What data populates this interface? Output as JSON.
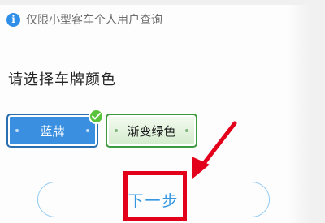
{
  "notice": {
    "icon": "info-icon",
    "icon_glyph": "i",
    "text": "仅限小型客车个人用户查询"
  },
  "prompt": {
    "text": "请选择车牌颜色"
  },
  "plates": [
    {
      "label": "蓝牌",
      "color": "#3a8fe0",
      "selected": true
    },
    {
      "label": "渐变绿色",
      "color": "#3d9a3d",
      "selected": false
    }
  ],
  "selected_badge": {
    "icon": "check-icon",
    "color": "#5bc23c"
  },
  "next_button": {
    "label": "下一步",
    "color": "#3597e2"
  },
  "annotation": {
    "color": "#e3001b"
  }
}
